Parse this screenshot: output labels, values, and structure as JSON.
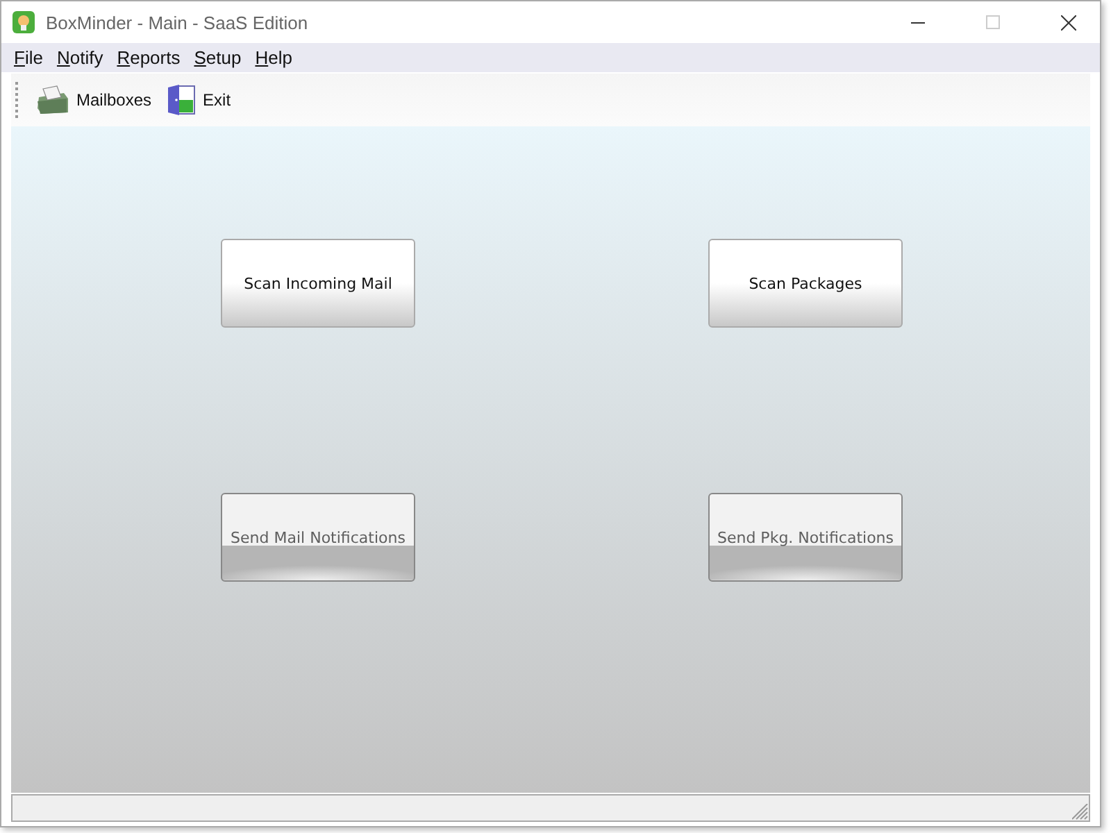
{
  "window": {
    "title": "BoxMinder - Main - SaaS Edition"
  },
  "menu": [
    {
      "label": "File"
    },
    {
      "label": "Notify"
    },
    {
      "label": "Reports"
    },
    {
      "label": "Setup"
    },
    {
      "label": "Help"
    }
  ],
  "toolbar": [
    {
      "label": "Mailboxes",
      "kind": "mailbox"
    },
    {
      "label": "Exit",
      "kind": "exit"
    }
  ],
  "actions": [
    {
      "label": "Scan Incoming Mail",
      "disabled": false
    },
    {
      "label": "Scan Packages",
      "disabled": false
    },
    {
      "label": "Send Mail Notifications",
      "disabled": true
    },
    {
      "label": "Send Pkg. Notifications",
      "disabled": true
    }
  ]
}
